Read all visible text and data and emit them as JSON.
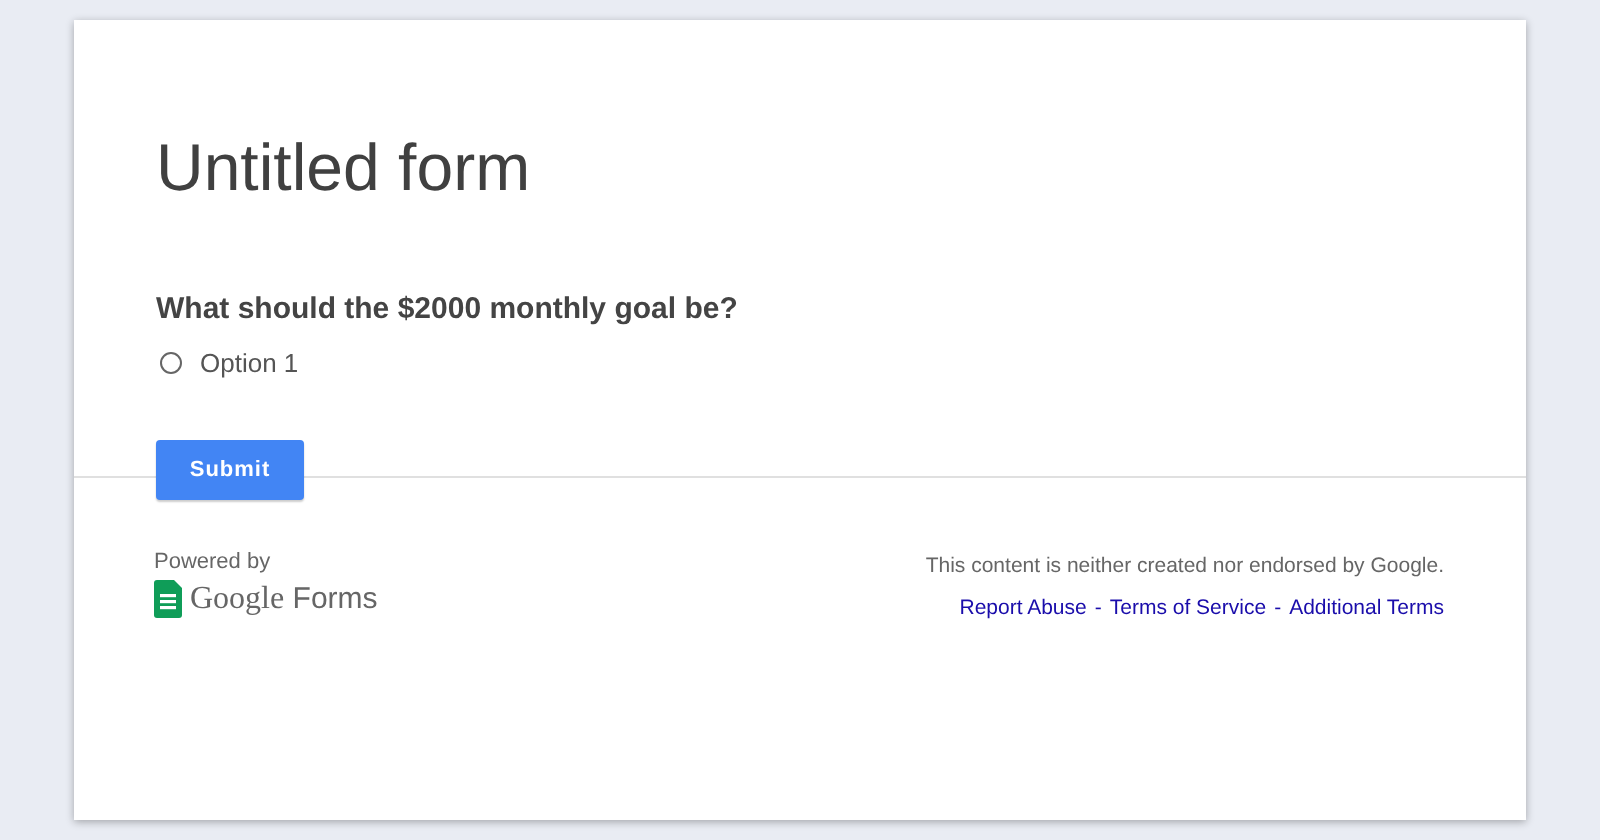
{
  "form": {
    "title": "Untitled form"
  },
  "question": {
    "text": "What should the $2000 monthly goal be?",
    "options": [
      {
        "label": "Option 1",
        "selected": false
      }
    ]
  },
  "submit": {
    "label": "Submit"
  },
  "footer": {
    "powered_by": "Powered by",
    "brand": {
      "google": "Google",
      "forms": "Forms"
    },
    "disclaimer": "This content is neither created nor endorsed by Google.",
    "links": [
      "Report Abuse",
      "Terms of Service",
      "Additional Terms"
    ],
    "separators": [
      "-",
      "-"
    ]
  }
}
